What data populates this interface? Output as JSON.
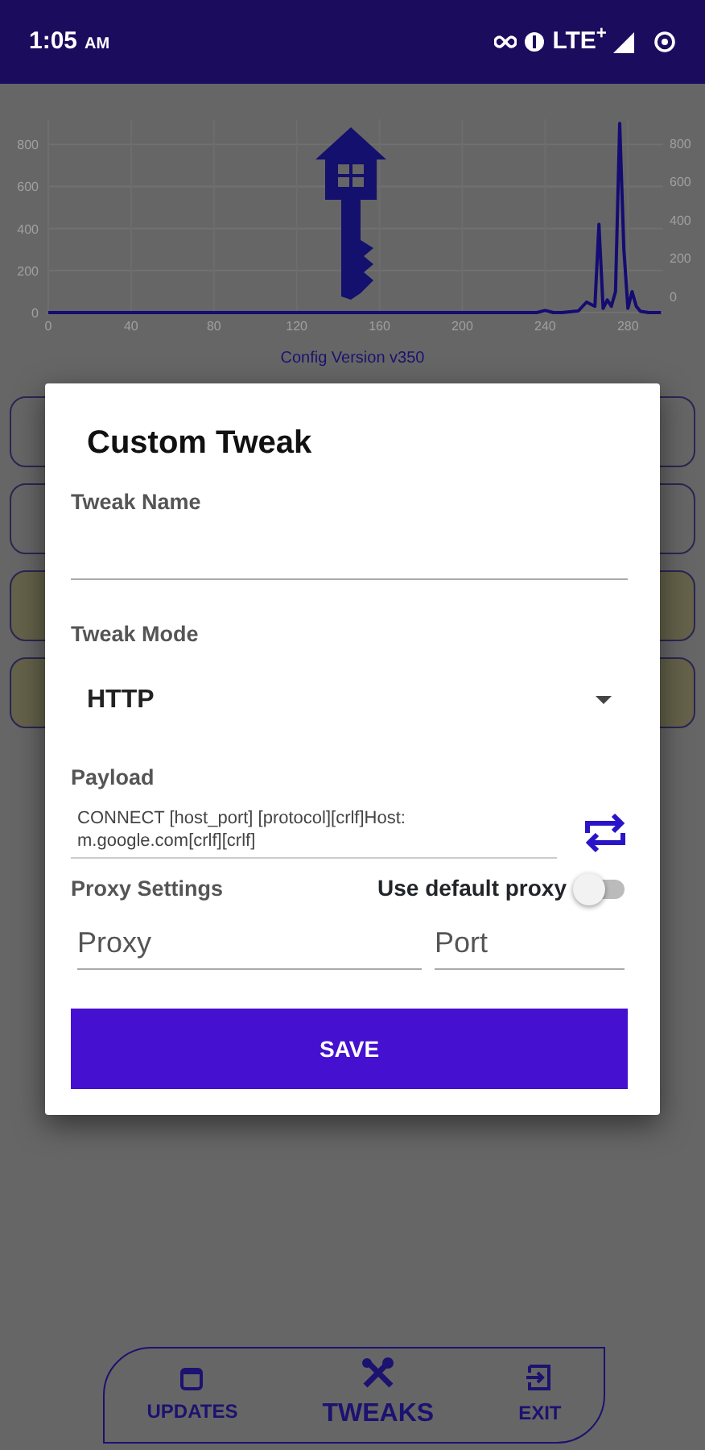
{
  "status_bar": {
    "time": "1:05",
    "meridiem": "AM",
    "network": "LTE$^{+}$"
  },
  "chart": {
    "chart_data": {
      "type": "line",
      "x": [
        0,
        40,
        80,
        120,
        160,
        200,
        236,
        240,
        244,
        248,
        256,
        260,
        264,
        266,
        268,
        270,
        272,
        274,
        276,
        278,
        280,
        282,
        284,
        286,
        290,
        296
      ],
      "series": [
        {
          "color": "#140c72",
          "values": [
            0,
            0,
            0,
            0,
            0,
            0,
            0,
            10,
            0,
            0,
            8,
            50,
            30,
            420,
            20,
            60,
            30,
            100,
            900,
            300,
            20,
            100,
            30,
            5,
            0,
            0
          ]
        }
      ],
      "xlim": [
        0,
        297
      ],
      "ylim": [
        0,
        920
      ],
      "xticks": [
        0,
        40,
        80,
        120,
        160,
        200,
        240,
        280
      ],
      "yticks": [
        0,
        200,
        400,
        600,
        800
      ],
      "y2ticks": [
        0,
        200,
        400,
        600,
        800
      ],
      "y2lim": [
        -84,
        924
      ],
      "grid": true
    }
  },
  "config_version": "Config Version  v350",
  "dialog": {
    "title": "Custom Tweak",
    "tweak_name": {
      "label": "Tweak Name"
    },
    "tweak_mode": {
      "label": "Tweak Mode",
      "value": "HTTP"
    },
    "payload": {
      "label": "Payload",
      "value": "CONNECT [host_port] [protocol][crlf]Host: m.google.com[crlf][crlf]"
    },
    "proxy_settings": {
      "label": "Proxy Settings",
      "toggle_label": "Use default proxy",
      "on": false
    },
    "proxy": {
      "placeholder": "Proxy"
    },
    "port": {
      "placeholder": "Port"
    },
    "save": "SAVE"
  },
  "bottom_nav": [
    {
      "kind": "calendar",
      "label": "UPDATES",
      "selected": false
    },
    {
      "kind": "tools",
      "label": "TWEAKS",
      "selected": true
    },
    {
      "kind": "exit",
      "label": "EXIT",
      "selected": false
    }
  ]
}
